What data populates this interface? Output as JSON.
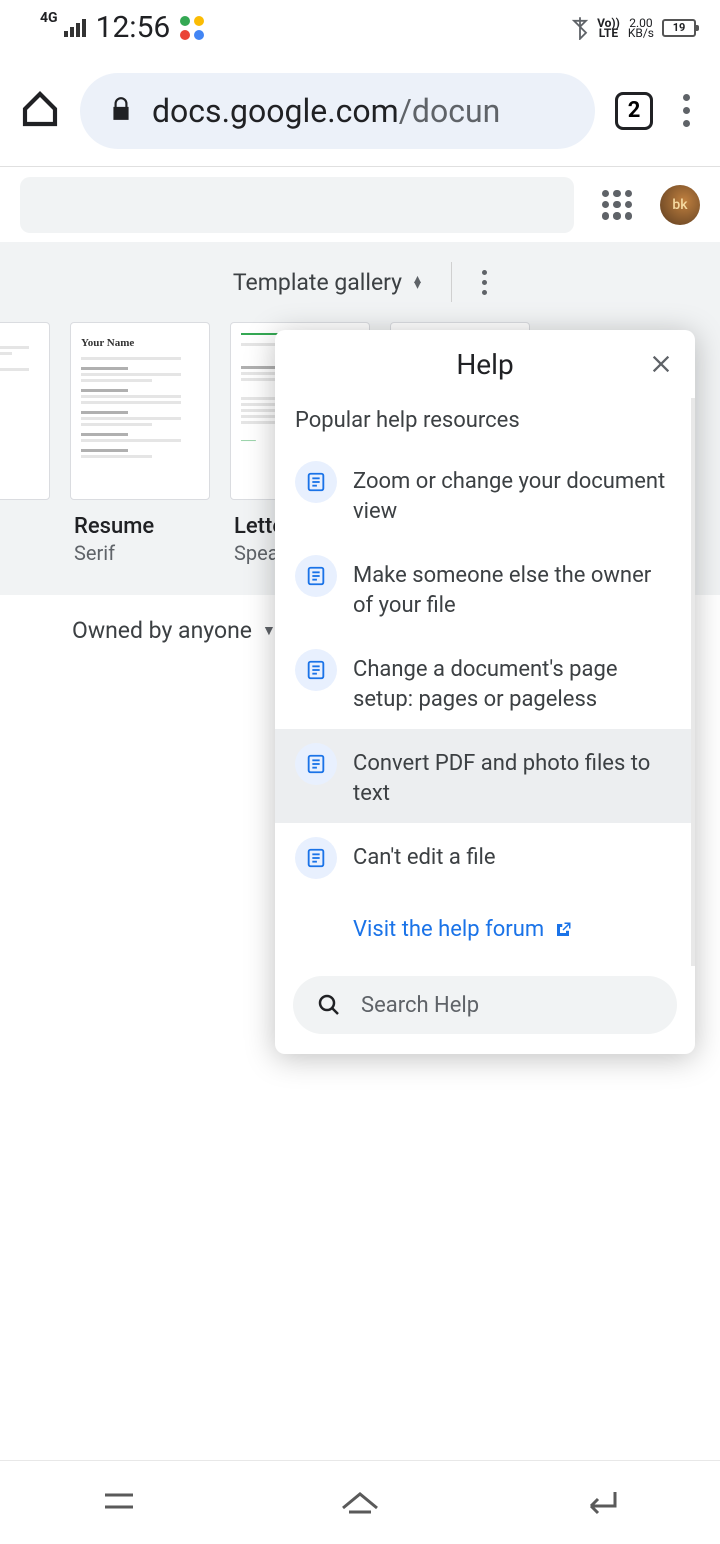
{
  "status": {
    "network": "4G",
    "time": "12:56",
    "volte_top": "Vo))",
    "volte_bot": "LTE",
    "speed_top": "2.00",
    "speed_bot": "KB/s",
    "battery": "19"
  },
  "browser": {
    "url_host": "docs.google.com",
    "url_path": "/docun",
    "tab_count": "2"
  },
  "gallery": {
    "label": "Template gallery",
    "templates": [
      {
        "title": "Resume",
        "subtitle": "Serif",
        "heading": "Your Name"
      },
      {
        "title": "Letter",
        "subtitle": "Spearmint",
        "heading": ""
      }
    ]
  },
  "filter": {
    "label": "Owned by anyone"
  },
  "help": {
    "title": "Help",
    "section": "Popular help resources",
    "items": [
      "Zoom or change your document view",
      "Make someone else the owner of your file",
      "Change a document's page setup: pages or pageless",
      "Convert PDF and photo files to text",
      "Can't edit a file"
    ],
    "forum": "Visit the help forum",
    "search_placeholder": "Search Help"
  },
  "avatar_text": "bk"
}
